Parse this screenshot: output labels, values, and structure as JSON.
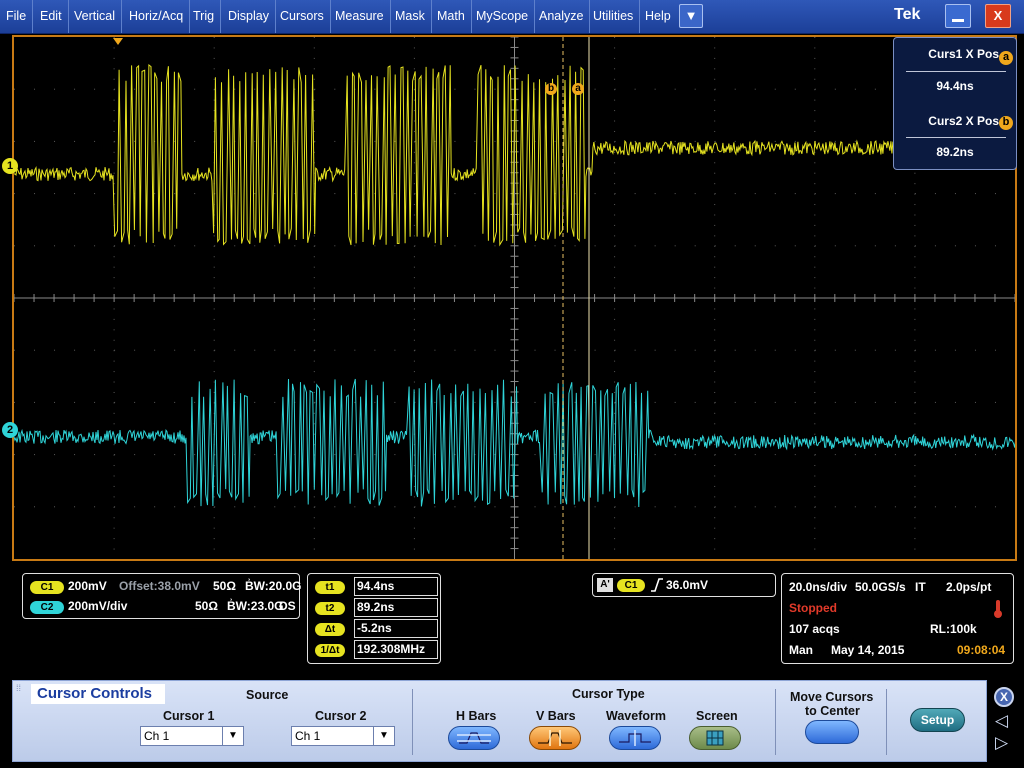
{
  "menu": {
    "items": [
      "File",
      "Edit",
      "Vertical",
      "Horiz/Acq",
      "Trig",
      "Display",
      "Cursors",
      "Measure",
      "Mask",
      "Math",
      "MyScope",
      "Analyze",
      "Utilities",
      "Help"
    ],
    "dropdown_icon": "chevron-down-icon",
    "brand": "Tek",
    "minimize_icon": "minimize-icon",
    "close_label": "X"
  },
  "cursor_readout": {
    "curs1_title": "Curs1 X Pos",
    "curs1_badge": "a",
    "curs1_value": "94.4ns",
    "curs2_title": "Curs2 X Pos",
    "curs2_badge": "b",
    "curs2_value": "89.2ns"
  },
  "display": {
    "ch1_marker": "1",
    "ch2_marker": "2",
    "cursor_a_label": "a",
    "cursor_b_label": "b",
    "colors": {
      "ch1": "#e6e320",
      "ch2": "#2fd4d8",
      "cursor_a": "#f0a81c",
      "cursor_b": "#e8c064",
      "frame": "#c87a14",
      "grid": "#5a5a5a"
    }
  },
  "channels": {
    "c1_label": "C1",
    "c1_scale": "200mV",
    "c1_offset": "Offset:38.0mV",
    "c1_impedance": "50Ω",
    "c1_bw": "B͗W:20.0G",
    "c2_label": "C2",
    "c2_scale": "200mV/div",
    "c2_impedance": "50Ω",
    "c2_bw": "B͗W:23.0G",
    "c2_suffix": "DS"
  },
  "cursor_table": [
    {
      "label": "t1",
      "value": "94.4ns"
    },
    {
      "label": "t2",
      "value": "89.2ns"
    },
    {
      "label": "Δt",
      "value": "-5.2ns"
    },
    {
      "label": "1/Δt",
      "value": "192.308MHz"
    }
  ],
  "trigger": {
    "mode": "A'",
    "source": "C1",
    "level": "36.0mV"
  },
  "acquisition": {
    "horizontal": "20.0ns/div",
    "sample_rate": "50.0GS/s",
    "mode_it": "IT",
    "resolution": "2.0ps/pt",
    "state": "Stopped",
    "acqs": "107 acqs",
    "record_length": "RL:100k",
    "trigger_mode": "Man",
    "date": "May 14, 2015",
    "time": "09:08:04"
  },
  "controls": {
    "title": "Cursor Controls",
    "source_label": "Source",
    "cursor1_label": "Cursor 1",
    "cursor1_value": "Ch 1",
    "cursor2_label": "Cursor 2",
    "cursor2_value": "Ch 1",
    "cursor_type_label": "Cursor Type",
    "types": [
      "H Bars",
      "V Bars",
      "Waveform",
      "Screen"
    ],
    "active_type": "V Bars",
    "move_label_1": "Move Cursors",
    "move_label_2": "to Center",
    "setup_label": "Setup",
    "close_label": "X"
  }
}
